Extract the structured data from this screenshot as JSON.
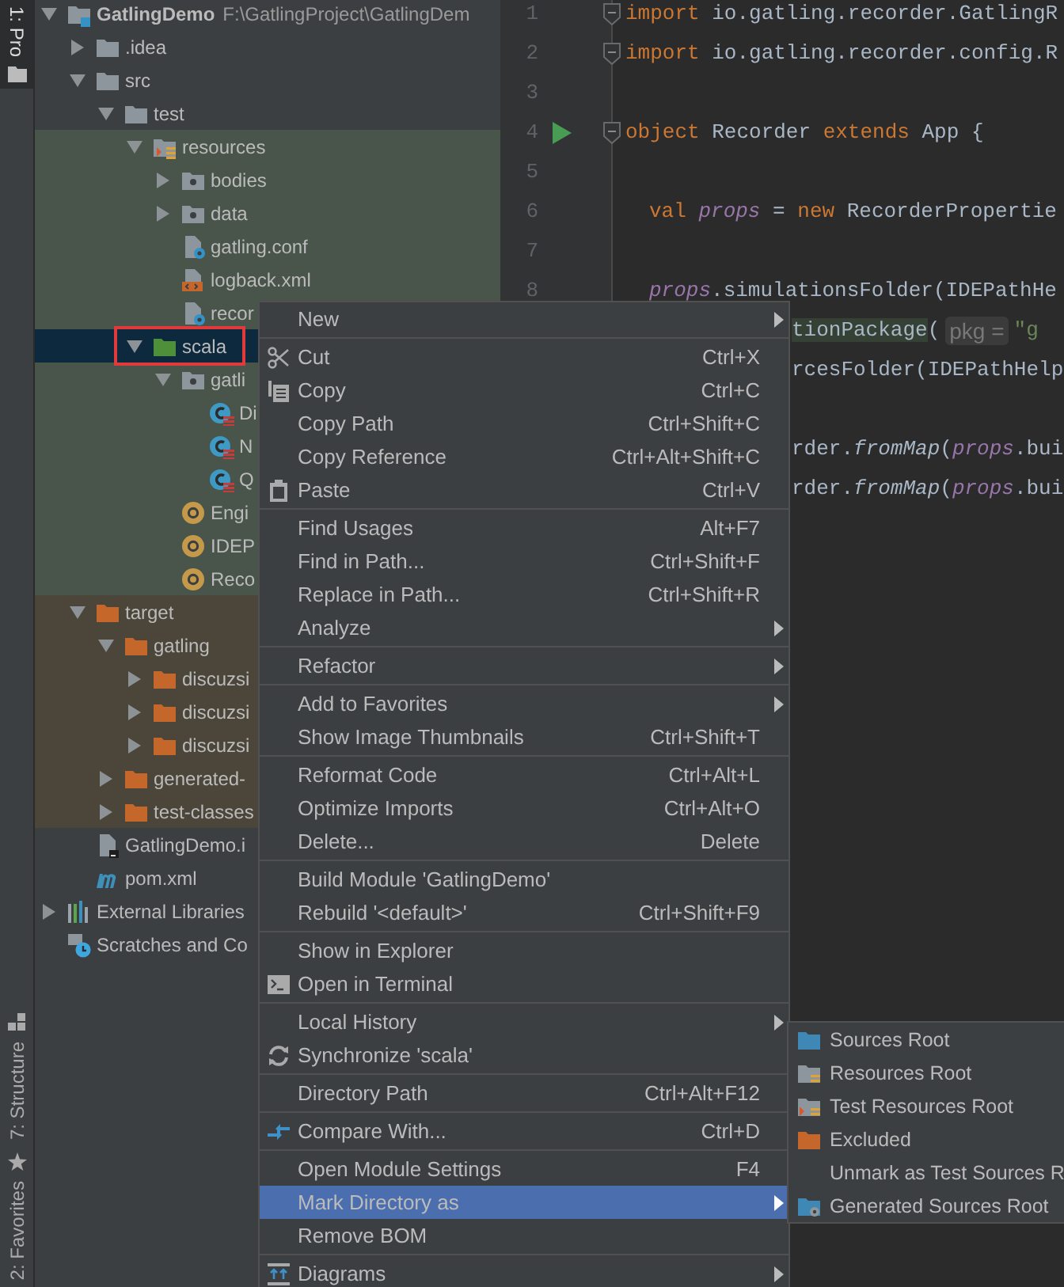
{
  "side_tabs": [
    {
      "label": "1: Pro",
      "selected": true
    },
    {
      "label": "7: Structure",
      "selected": false
    },
    {
      "label": "2: Favorites",
      "selected": false
    }
  ],
  "project_tree": [
    {
      "label": "GatlingDemo",
      "path": "F:\\GatlingProject\\GatlingDem",
      "kind": "module",
      "expanded": true,
      "selected": false,
      "children": [
        {
          "label": ".idea",
          "kind": "folder",
          "expanded": false,
          "selected": false
        },
        {
          "label": "src",
          "kind": "folder",
          "expanded": true,
          "selected": false,
          "children": [
            {
              "label": "test",
              "kind": "folder",
              "expanded": true,
              "selected": false,
              "children": [
                {
                  "label": "resources",
                  "kind": "resources-root",
                  "expanded": true,
                  "selected": false,
                  "children": [
                    {
                      "label": "bodies",
                      "kind": "package",
                      "expanded": false,
                      "selected": false
                    },
                    {
                      "label": "data",
                      "kind": "package",
                      "expanded": false,
                      "selected": false
                    },
                    {
                      "label": "gatling.conf",
                      "kind": "config-file",
                      "selected": false
                    },
                    {
                      "label": "logback.xml",
                      "kind": "xml-file",
                      "selected": false
                    },
                    {
                      "label": "recor",
                      "kind": "config-file",
                      "selected": false
                    }
                  ]
                },
                {
                  "label": "scala",
                  "kind": "source-root",
                  "expanded": true,
                  "selected": true,
                  "marked": true,
                  "children": [
                    {
                      "label": "gatli",
                      "kind": "package",
                      "expanded": true,
                      "selected": false,
                      "children": [
                        {
                          "label": "Di",
                          "kind": "scala-class",
                          "selected": false
                        },
                        {
                          "label": "N",
                          "kind": "scala-class",
                          "selected": false
                        },
                        {
                          "label": "Q",
                          "kind": "scala-class",
                          "selected": false
                        }
                      ]
                    },
                    {
                      "label": "Engi",
                      "kind": "scala-object",
                      "selected": false
                    },
                    {
                      "label": "IDEP",
                      "kind": "scala-object",
                      "selected": false
                    },
                    {
                      "label": "Reco",
                      "kind": "scala-object",
                      "selected": false
                    }
                  ]
                }
              ]
            }
          ]
        },
        {
          "label": "target",
          "kind": "excluded-folder",
          "expanded": true,
          "selected": false,
          "children": [
            {
              "label": "gatling",
              "kind": "excluded-folder",
              "expanded": true,
              "selected": false,
              "children": [
                {
                  "label": "discuzsi",
                  "kind": "excluded-folder",
                  "expanded": false,
                  "selected": false
                },
                {
                  "label": "discuzsi",
                  "kind": "excluded-folder",
                  "expanded": false,
                  "selected": false
                },
                {
                  "label": "discuzsi",
                  "kind": "excluded-folder",
                  "expanded": false,
                  "selected": false
                }
              ]
            },
            {
              "label": "generated-",
              "kind": "excluded-folder",
              "expanded": false,
              "selected": false
            },
            {
              "label": "test-classes",
              "kind": "excluded-folder",
              "expanded": false,
              "selected": false
            }
          ]
        },
        {
          "label": "GatlingDemo.i",
          "kind": "iml-file",
          "selected": false
        },
        {
          "label": "pom.xml",
          "kind": "maven-file",
          "selected": false
        }
      ]
    },
    {
      "label": "External Libraries",
      "kind": "libraries",
      "expanded": false,
      "selected": false
    },
    {
      "label": "Scratches and Co",
      "kind": "scratches",
      "selected": false
    }
  ],
  "editor": {
    "lines": [
      {
        "number": "1",
        "fold": true,
        "segments": [
          {
            "text": "import",
            "kind": "keyword"
          },
          {
            "text": " io.gatling.recorder.GatlingR",
            "kind": "plain"
          }
        ]
      },
      {
        "number": "2",
        "fold": true,
        "segments": [
          {
            "text": "import",
            "kind": "keyword"
          },
          {
            "text": " io.gatling.recorder.config.R",
            "kind": "plain"
          }
        ]
      },
      {
        "number": "3"
      },
      {
        "number": "4",
        "fold": true,
        "run": true,
        "segments": [
          {
            "text": "object",
            "kind": "keyword"
          },
          {
            "text": " Recorder ",
            "kind": "plain"
          },
          {
            "text": "extends",
            "kind": "keyword"
          },
          {
            "text": " App {",
            "kind": "plain"
          }
        ]
      },
      {
        "number": "5"
      },
      {
        "number": "6",
        "indented": true,
        "segments": [
          {
            "text": "val ",
            "kind": "keyword"
          },
          {
            "text": "props",
            "kind": "field"
          },
          {
            "text": " = ",
            "kind": "plain"
          },
          {
            "text": "new",
            "kind": "keyword"
          },
          {
            "text": " RecorderPropertie",
            "kind": "plain"
          }
        ]
      },
      {
        "number": "7"
      },
      {
        "number": "8",
        "indented": true,
        "segments": [
          {
            "text": "props",
            "kind": "field"
          },
          {
            "text": ".simulationsFolder(IDEPathHe",
            "kind": "plain"
          }
        ]
      },
      {
        "segments": [
          {
            "text": "tionPackage",
            "kind": "highlight"
          },
          {
            "text": "(",
            "kind": "plain"
          },
          {
            "text": "pkg =",
            "kind": "hint"
          },
          {
            "text": "\"g",
            "kind": "string"
          }
        ]
      },
      {
        "segments": [
          {
            "text": "rcesFolder(IDEPathHelp",
            "kind": "plain"
          }
        ]
      },
      {
        "blank_before": true,
        "segments": [
          {
            "text": "rder.",
            "kind": "plain"
          },
          {
            "text": "fromMap",
            "kind": "method"
          },
          {
            "text": "(",
            "kind": "plain"
          },
          {
            "text": "props",
            "kind": "field"
          },
          {
            "text": ".bui",
            "kind": "plain"
          }
        ]
      },
      {
        "segments": [
          {
            "text": "rder.",
            "kind": "plain"
          },
          {
            "text": "fromMap",
            "kind": "method"
          },
          {
            "text": "(",
            "kind": "plain"
          },
          {
            "text": "props",
            "kind": "field"
          },
          {
            "text": ".bui",
            "kind": "plain"
          }
        ]
      }
    ]
  },
  "context_menu": {
    "groups": [
      [
        {
          "label": "New",
          "submenu": true,
          "selected": false
        }
      ],
      [
        {
          "label": "Cut",
          "shortcut": "Ctrl+X",
          "kind": "cut",
          "selected": false
        },
        {
          "label": "Copy",
          "shortcut": "Ctrl+C",
          "kind": "copy",
          "selected": false
        },
        {
          "label": "Copy Path",
          "shortcut": "Ctrl+Shift+C",
          "selected": false
        },
        {
          "label": "Copy Reference",
          "shortcut": "Ctrl+Alt+Shift+C",
          "selected": false
        },
        {
          "label": "Paste",
          "shortcut": "Ctrl+V",
          "kind": "paste",
          "selected": false
        }
      ],
      [
        {
          "label": "Find Usages",
          "shortcut": "Alt+F7",
          "selected": false
        },
        {
          "label": "Find in Path...",
          "shortcut": "Ctrl+Shift+F",
          "selected": false
        },
        {
          "label": "Replace in Path...",
          "shortcut": "Ctrl+Shift+R",
          "selected": false
        },
        {
          "label": "Analyze",
          "submenu": true,
          "selected": false
        }
      ],
      [
        {
          "label": "Refactor",
          "submenu": true,
          "selected": false
        }
      ],
      [
        {
          "label": "Add to Favorites",
          "submenu": true,
          "selected": false
        },
        {
          "label": "Show Image Thumbnails",
          "shortcut": "Ctrl+Shift+T",
          "selected": false
        }
      ],
      [
        {
          "label": "Reformat Code",
          "shortcut": "Ctrl+Alt+L",
          "selected": false
        },
        {
          "label": "Optimize Imports",
          "shortcut": "Ctrl+Alt+O",
          "selected": false
        },
        {
          "label": "Delete...",
          "shortcut": "Delete",
          "selected": false
        }
      ],
      [
        {
          "label": "Build Module 'GatlingDemo'",
          "selected": false
        },
        {
          "label": "Rebuild '<default>'",
          "shortcut": "Ctrl+Shift+F9",
          "selected": false
        }
      ],
      [
        {
          "label": "Show in Explorer",
          "selected": false
        },
        {
          "label": "Open in Terminal",
          "kind": "terminal",
          "selected": false
        }
      ],
      [
        {
          "label": "Local History",
          "submenu": true,
          "selected": false
        },
        {
          "label": "Synchronize 'scala'",
          "kind": "sync",
          "selected": false
        }
      ],
      [
        {
          "label": "Directory Path",
          "shortcut": "Ctrl+Alt+F12",
          "selected": false
        }
      ],
      [
        {
          "label": "Compare With...",
          "shortcut": "Ctrl+D",
          "kind": "compare",
          "selected": false
        }
      ],
      [
        {
          "label": "Open Module Settings",
          "shortcut": "F4",
          "selected": false
        },
        {
          "label": "Mark Directory as",
          "submenu": true,
          "selected": true
        },
        {
          "label": "Remove BOM",
          "selected": false
        }
      ],
      [
        {
          "label": "Diagrams",
          "submenu": true,
          "kind": "diagram",
          "selected": false
        }
      ]
    ]
  },
  "submenu": {
    "items": [
      {
        "label": "Sources Root",
        "kind": "sources-root"
      },
      {
        "label": "Resources Root",
        "kind": "resources-root"
      },
      {
        "label": "Test Resources Root",
        "kind": "test-resources-root"
      },
      {
        "label": "Excluded",
        "kind": "excluded"
      },
      {
        "label": "Unmark as Test Sources R",
        "kind": "plain"
      },
      {
        "label": "Generated Sources Root",
        "kind": "generated-root"
      }
    ]
  }
}
